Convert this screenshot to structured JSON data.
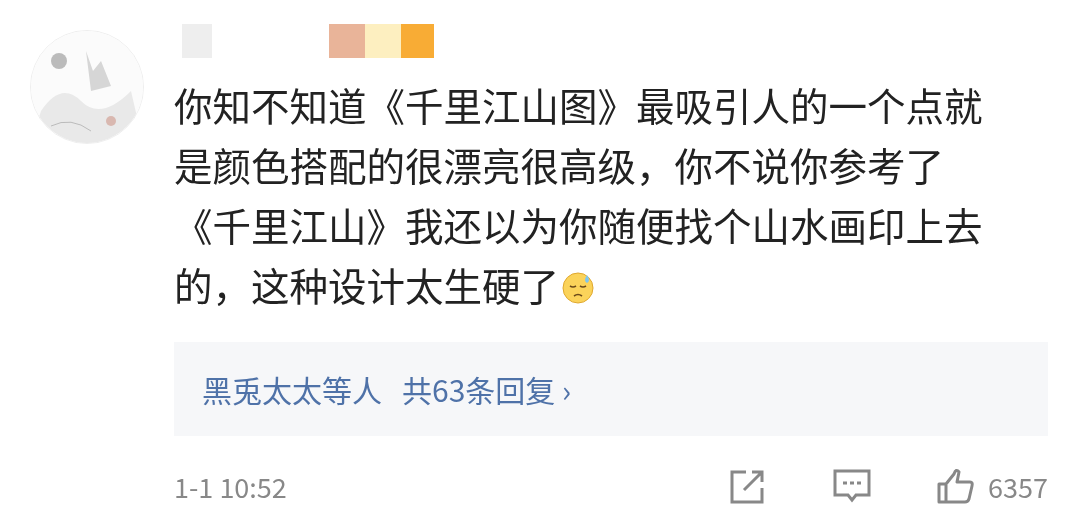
{
  "comment": {
    "lines": [
      "你知不知道《千里江山图》最吸引人的一个点就",
      "是颜色搭配的很漂亮很高级，你不说你参考了",
      "《千里江山》我还以为你随便找个山水画印上去",
      "的，这种设计太生硬了"
    ],
    "replies": {
      "names": "黑兎太太等人",
      "count": "共63条回复",
      "arrow": "›"
    },
    "time": "1-1 10:52",
    "likes": "6357"
  }
}
